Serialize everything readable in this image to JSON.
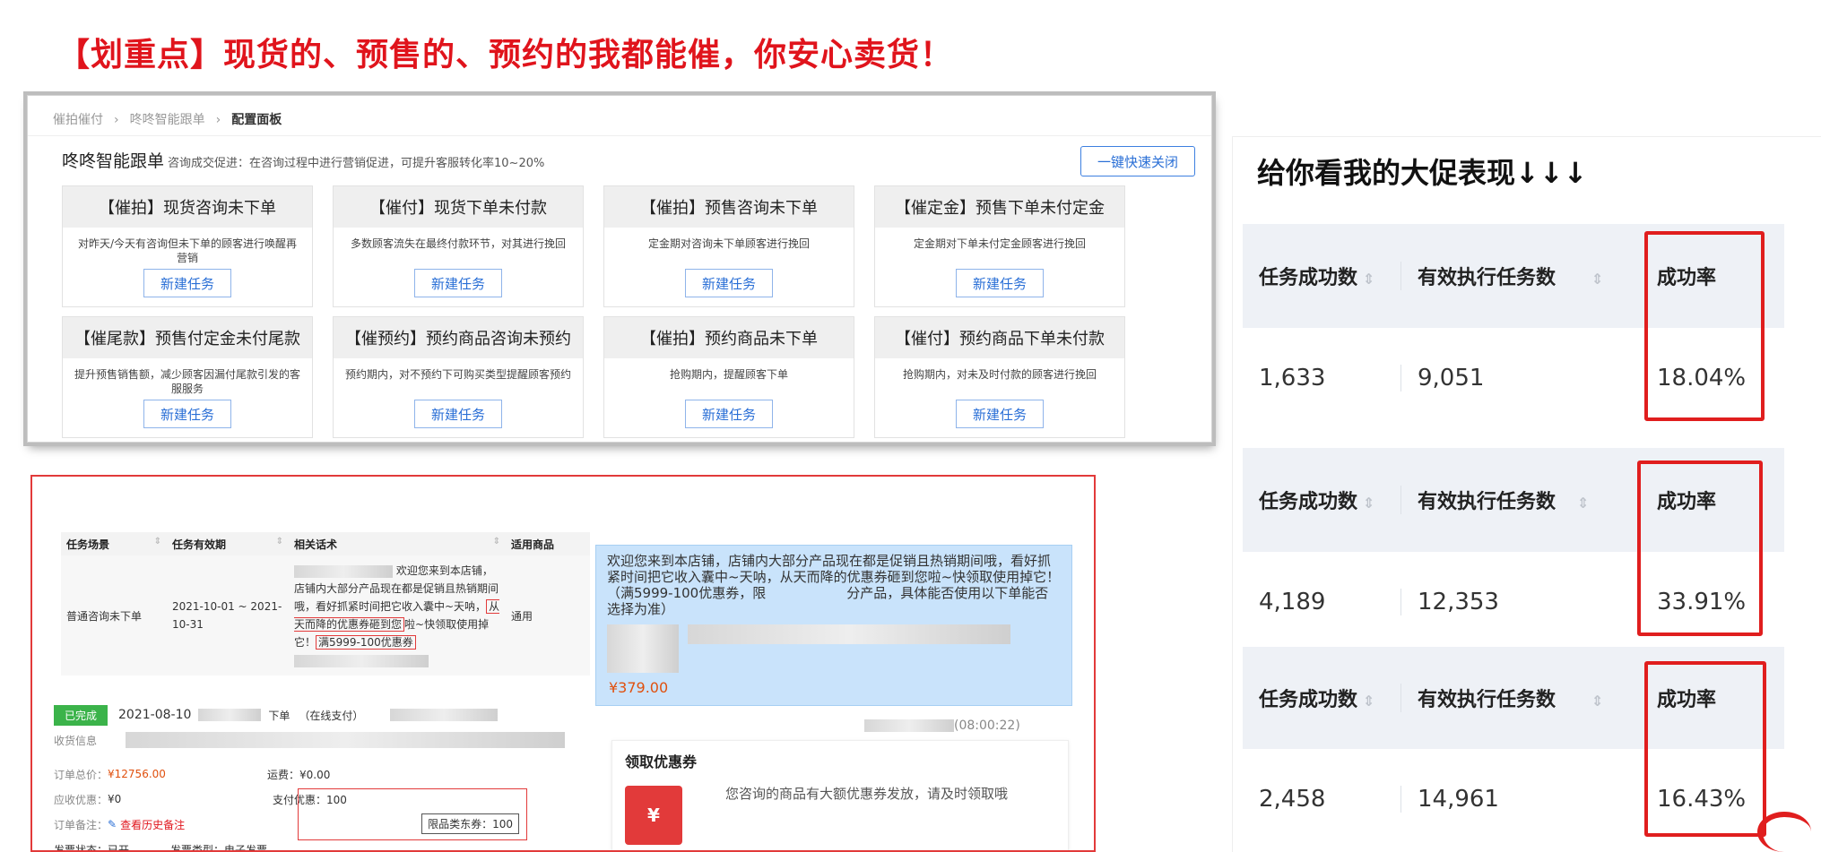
{
  "headline": "【划重点】现货的、预售的、预约的我都能催，你安心卖货！",
  "config": {
    "breadcrumb": [
      "催拍催付",
      "咚咚智能跟单",
      "配置面板"
    ],
    "title": "咚咚智能跟单",
    "subtitle": "咨询成交促进：在咨询过程中进行营销促进，可提升客服转化率10~20%",
    "quick_close": "一键快速关闭",
    "cards": [
      {
        "title": "【催拍】现货咨询未下单",
        "desc": "对昨天/今天有咨询但未下单的顾客进行唤醒再营销",
        "button": "新建任务"
      },
      {
        "title": "【催付】现货下单未付款",
        "desc": "多数顾客流失在最终付款环节，对其进行挽回",
        "button": "新建任务"
      },
      {
        "title": "【催拍】预售咨询未下单",
        "desc": "定金期对咨询未下单顾客进行挽回",
        "button": "新建任务"
      },
      {
        "title": "【催定金】预售下单未付定金",
        "desc": "定金期对下单未付定金顾客进行挽回",
        "button": "新建任务"
      },
      {
        "title": "【催尾款】预售付定金未付尾款",
        "desc": "提升预售销售额，减少顾客因漏付尾款引发的客服服务",
        "button": "新建任务"
      },
      {
        "title": "【催预约】预约商品咨询未预约",
        "desc": "预约期内，对不预约下可购买类型提醒顾客预约",
        "button": "新建任务"
      },
      {
        "title": "【催拍】预约商品未下单",
        "desc": "抢购期内，提醒顾客下单",
        "button": "新建任务"
      },
      {
        "title": "【催付】预约商品下单未付款",
        "desc": "抢购期内，对未及时付款的顾客进行挽回",
        "button": "新建任务"
      }
    ]
  },
  "task_table": {
    "headers": [
      "任务场景",
      "任务有效期",
      "相关话术",
      "适用商品"
    ],
    "row": {
      "scene": "普通咨询未下单",
      "period": "2021-10-01 ~ 2021-10-31",
      "script_a": "欢迎您来到本店铺，店铺内大部分产品现在都是促销且热销期间哦，看好抓紧时间把它收入囊中~天呐，",
      "script_hl1": "从天而降的优惠券砸到您",
      "script_b": "啦~快领取使用掉它！",
      "script_hl2": "满5999-100优惠券",
      "product": "通用"
    }
  },
  "order": {
    "status": "已完成",
    "date": "2021-08-10",
    "type": "下单",
    "pay_mode": "（在线支付）",
    "receive_label": "收货信息",
    "total_label": "订单总价：",
    "total": "¥12756.00",
    "freight": "运费：¥0.00",
    "discount_label": "应收优惠：",
    "discount": "¥0",
    "pay_discount": "支付优惠：100",
    "remark_label": "订单备注：",
    "remark_link": "查看历史备注",
    "jd_coupon": "限品类东券：100",
    "invoice_status": "发票状态：已开",
    "invoice_type": "发票类型：电子发票"
  },
  "chat": {
    "message": "欢迎您来到本店铺，店铺内大部分产品现在都是促销且热销期间哦，看好抓紧时间把它收入囊中~天呐，从天而降的优惠券砸到您啦~快领取使用掉它！（满5999-100优惠券，限　　　　　　分产品，具体能否使用以下单能否选择为准）",
    "price": "¥379.00",
    "time": "(08:00:22)",
    "coupon_title": "领取优惠券",
    "coupon_icon": "¥",
    "coupon_text": "您咨询的商品有大额优惠券发放，请及时领取哦"
  },
  "stats": {
    "title": "给你看我的大促表现↓↓↓",
    "headers": [
      "任务成功数",
      "有效执行任务数",
      "成功率"
    ],
    "tables": [
      {
        "success": "1,633",
        "executed": "9,051",
        "rate": "18.04%"
      },
      {
        "success": "4,189",
        "executed": "12,353",
        "rate": "33.91%"
      },
      {
        "success": "2,458",
        "executed": "14,961",
        "rate": "16.43%"
      }
    ]
  },
  "colors": {
    "accent_red": "#e0141c",
    "link_blue": "#2a6fd6",
    "status_green": "#3bb34a",
    "bubble_blue": "#c9e3fb"
  }
}
